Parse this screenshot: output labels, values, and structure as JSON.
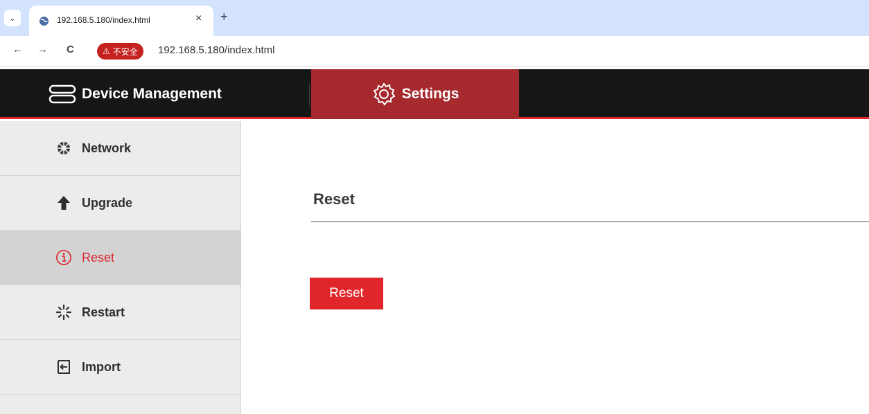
{
  "browser": {
    "tab_title": "192.168.5.180/index.html",
    "tab_close": "×",
    "new_tab": "+",
    "tab_menu": "⌄",
    "back": "←",
    "forward": "→",
    "reload": "C",
    "insecure_label": "不安全",
    "url": "192.168.5.180/index.html"
  },
  "header": {
    "device_management": "Device Management",
    "settings": "Settings"
  },
  "sidebar": {
    "items": [
      {
        "label": "Network",
        "icon": "network-icon"
      },
      {
        "label": "Upgrade",
        "icon": "arrow-up-icon"
      },
      {
        "label": "Reset",
        "icon": "info-circle-icon",
        "active": true
      },
      {
        "label": "Restart",
        "icon": "spinner-icon"
      },
      {
        "label": "Import",
        "icon": "import-icon"
      }
    ]
  },
  "main": {
    "title": "Reset",
    "button_label": "Reset"
  },
  "colors": {
    "accent": "#e0262a",
    "header_bg": "#161616",
    "settings_bg": "#a5292d",
    "sidebar_bg": "#ececec",
    "sidebar_active": "#d3d3d3"
  }
}
